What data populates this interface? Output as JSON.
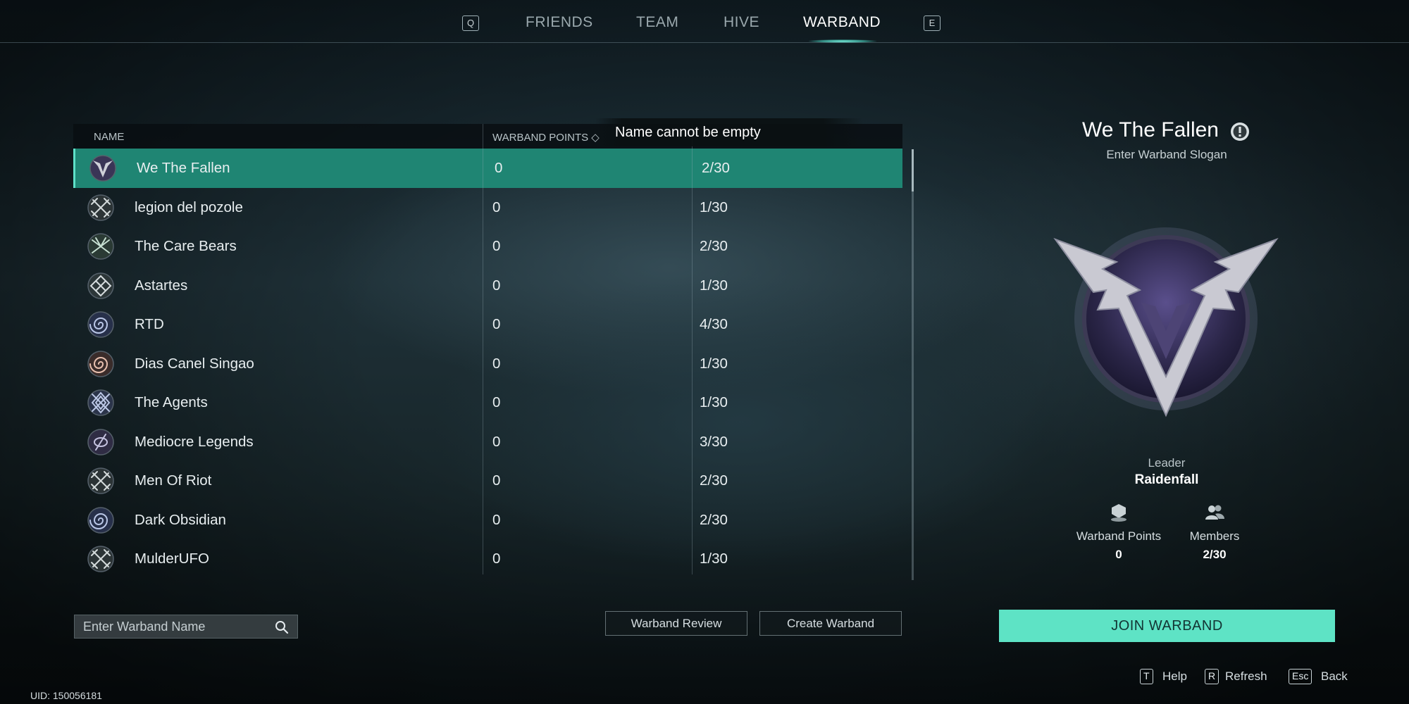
{
  "nav": {
    "left_key": "Q",
    "right_key": "E",
    "tabs": [
      "FRIENDS",
      "TEAM",
      "HIVE",
      "WARBAND"
    ],
    "active_tab": "WARBAND"
  },
  "table": {
    "headers": {
      "name": "NAME",
      "points": "WARBAND POINTS ◇"
    },
    "toast": "Name cannot be empty",
    "rows": [
      {
        "name": "We The Fallen",
        "points": "0",
        "members": "2/30",
        "selected": true,
        "emblem": "fallen-v-emblem-icon"
      },
      {
        "name": "legion del pozole",
        "points": "0",
        "members": "1/30",
        "emblem": "crossed-swords-emblem-icon"
      },
      {
        "name": "The Care Bears",
        "points": "0",
        "members": "2/30",
        "emblem": "crossed-blades-emblem-icon"
      },
      {
        "name": "Astartes",
        "points": "0",
        "members": "1/30",
        "emblem": "lattice-emblem-icon"
      },
      {
        "name": "RTD",
        "points": "0",
        "members": "4/30",
        "emblem": "spiral-emblem-icon"
      },
      {
        "name": "Dias Canel Singao",
        "points": "0",
        "members": "1/30",
        "emblem": "spiral-orange-emblem-icon"
      },
      {
        "name": "The Agents",
        "points": "0",
        "members": "1/30",
        "emblem": "diamond-emblem-icon"
      },
      {
        "name": "Mediocre Legends",
        "points": "0",
        "members": "3/30",
        "emblem": "slash-emblem-icon"
      },
      {
        "name": "Men Of Riot",
        "points": "0",
        "members": "2/30",
        "emblem": "crossed-swords-emblem-icon"
      },
      {
        "name": "Dark Obsidian",
        "points": "0",
        "members": "2/30",
        "emblem": "spiral-emblem-icon"
      },
      {
        "name": "MulderUFO",
        "points": "0",
        "members": "1/30",
        "emblem": "crossed-swords-emblem-icon"
      }
    ]
  },
  "search": {
    "placeholder": "Enter Warband Name"
  },
  "buttons": {
    "review": "Warband Review",
    "create": "Create Warband",
    "join": "JOIN WARBAND"
  },
  "detail": {
    "title": "We The Fallen",
    "slogan": "Enter Warband Slogan",
    "leader_label": "Leader",
    "leader_name": "Raidenfall",
    "points_label": "Warband Points",
    "points_value": "0",
    "members_label": "Members",
    "members_value": "2/30"
  },
  "hints": [
    {
      "key": "T",
      "label": "Help"
    },
    {
      "key": "R",
      "label": "Refresh"
    },
    {
      "key": "Esc",
      "label": "Back"
    }
  ],
  "uid": "UID: 150056181",
  "colors": {
    "accent": "#5ee3c5",
    "selected_row": "#1f8573"
  }
}
